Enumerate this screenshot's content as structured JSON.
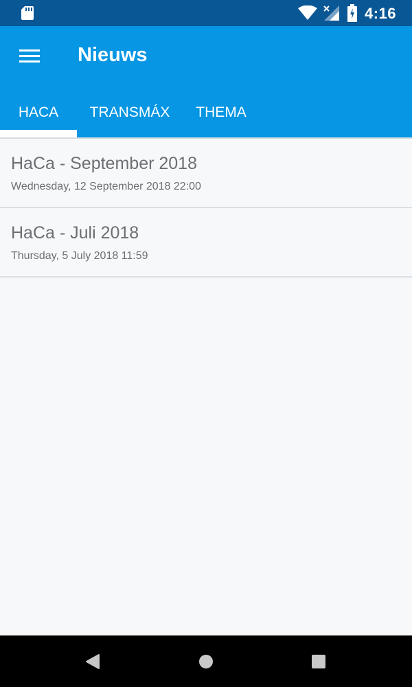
{
  "status_bar": {
    "time": "4:16",
    "icons": [
      "sd-card-icon",
      "wifi-icon",
      "signal-icon",
      "battery-charging-icon"
    ]
  },
  "app_bar": {
    "title": "Nieuws",
    "menu_icon": "hamburger-menu-icon"
  },
  "tabs": [
    {
      "label": "HACA",
      "selected": true
    },
    {
      "label": "TRANSMÁX",
      "selected": false
    },
    {
      "label": "THEMA",
      "selected": false
    }
  ],
  "news_items": [
    {
      "title": "HaCa - September 2018",
      "date": "Wednesday, 12 September 2018 22:00"
    },
    {
      "title": "HaCa - Juli 2018",
      "date": "Thursday, 5 July 2018 11:59"
    }
  ],
  "nav_bar": {
    "icons": [
      "back-icon",
      "home-icon",
      "recents-icon"
    ]
  },
  "colors": {
    "status_bar": "#0a5796",
    "primary": "#0696e3",
    "background": "#f7f8fa",
    "text_secondary": "#6c6f73"
  }
}
